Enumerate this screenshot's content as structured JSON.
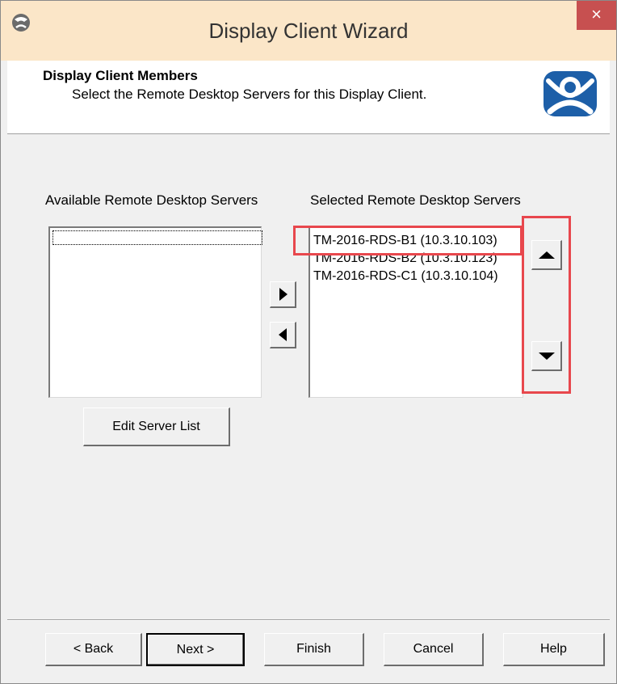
{
  "window": {
    "title": "Display Client Wizard",
    "close_label": "×"
  },
  "header": {
    "title": "Display Client Members",
    "subtitle": "Select the Remote Desktop Servers for this Display Client."
  },
  "available": {
    "label": "Available Remote Desktop Servers",
    "items": []
  },
  "selected": {
    "label": "Selected Remote Desktop Servers",
    "items": [
      "TM-2016-RDS-B1 (10.3.10.103)",
      "TM-2016-RDS-B2 (10.3.10.123)",
      "TM-2016-RDS-C1 (10.3.10.104)"
    ]
  },
  "buttons": {
    "edit_server_list": "Edit Server List",
    "back": "< Back",
    "next": "Next >",
    "finish": "Finish",
    "cancel": "Cancel",
    "help": "Help"
  },
  "icons": {
    "add": "triangle-right-icon",
    "remove": "triangle-left-icon",
    "move_up": "triangle-up-icon",
    "move_down": "triangle-down-icon",
    "app": "terminal-manager-icon",
    "logo": "terminal-manager-logo-icon"
  },
  "colors": {
    "titlebar": "#fbe6c8",
    "close_button": "#c75050",
    "annotation_highlight": "#e8474d",
    "logo_blue": "#1d5fa8"
  }
}
